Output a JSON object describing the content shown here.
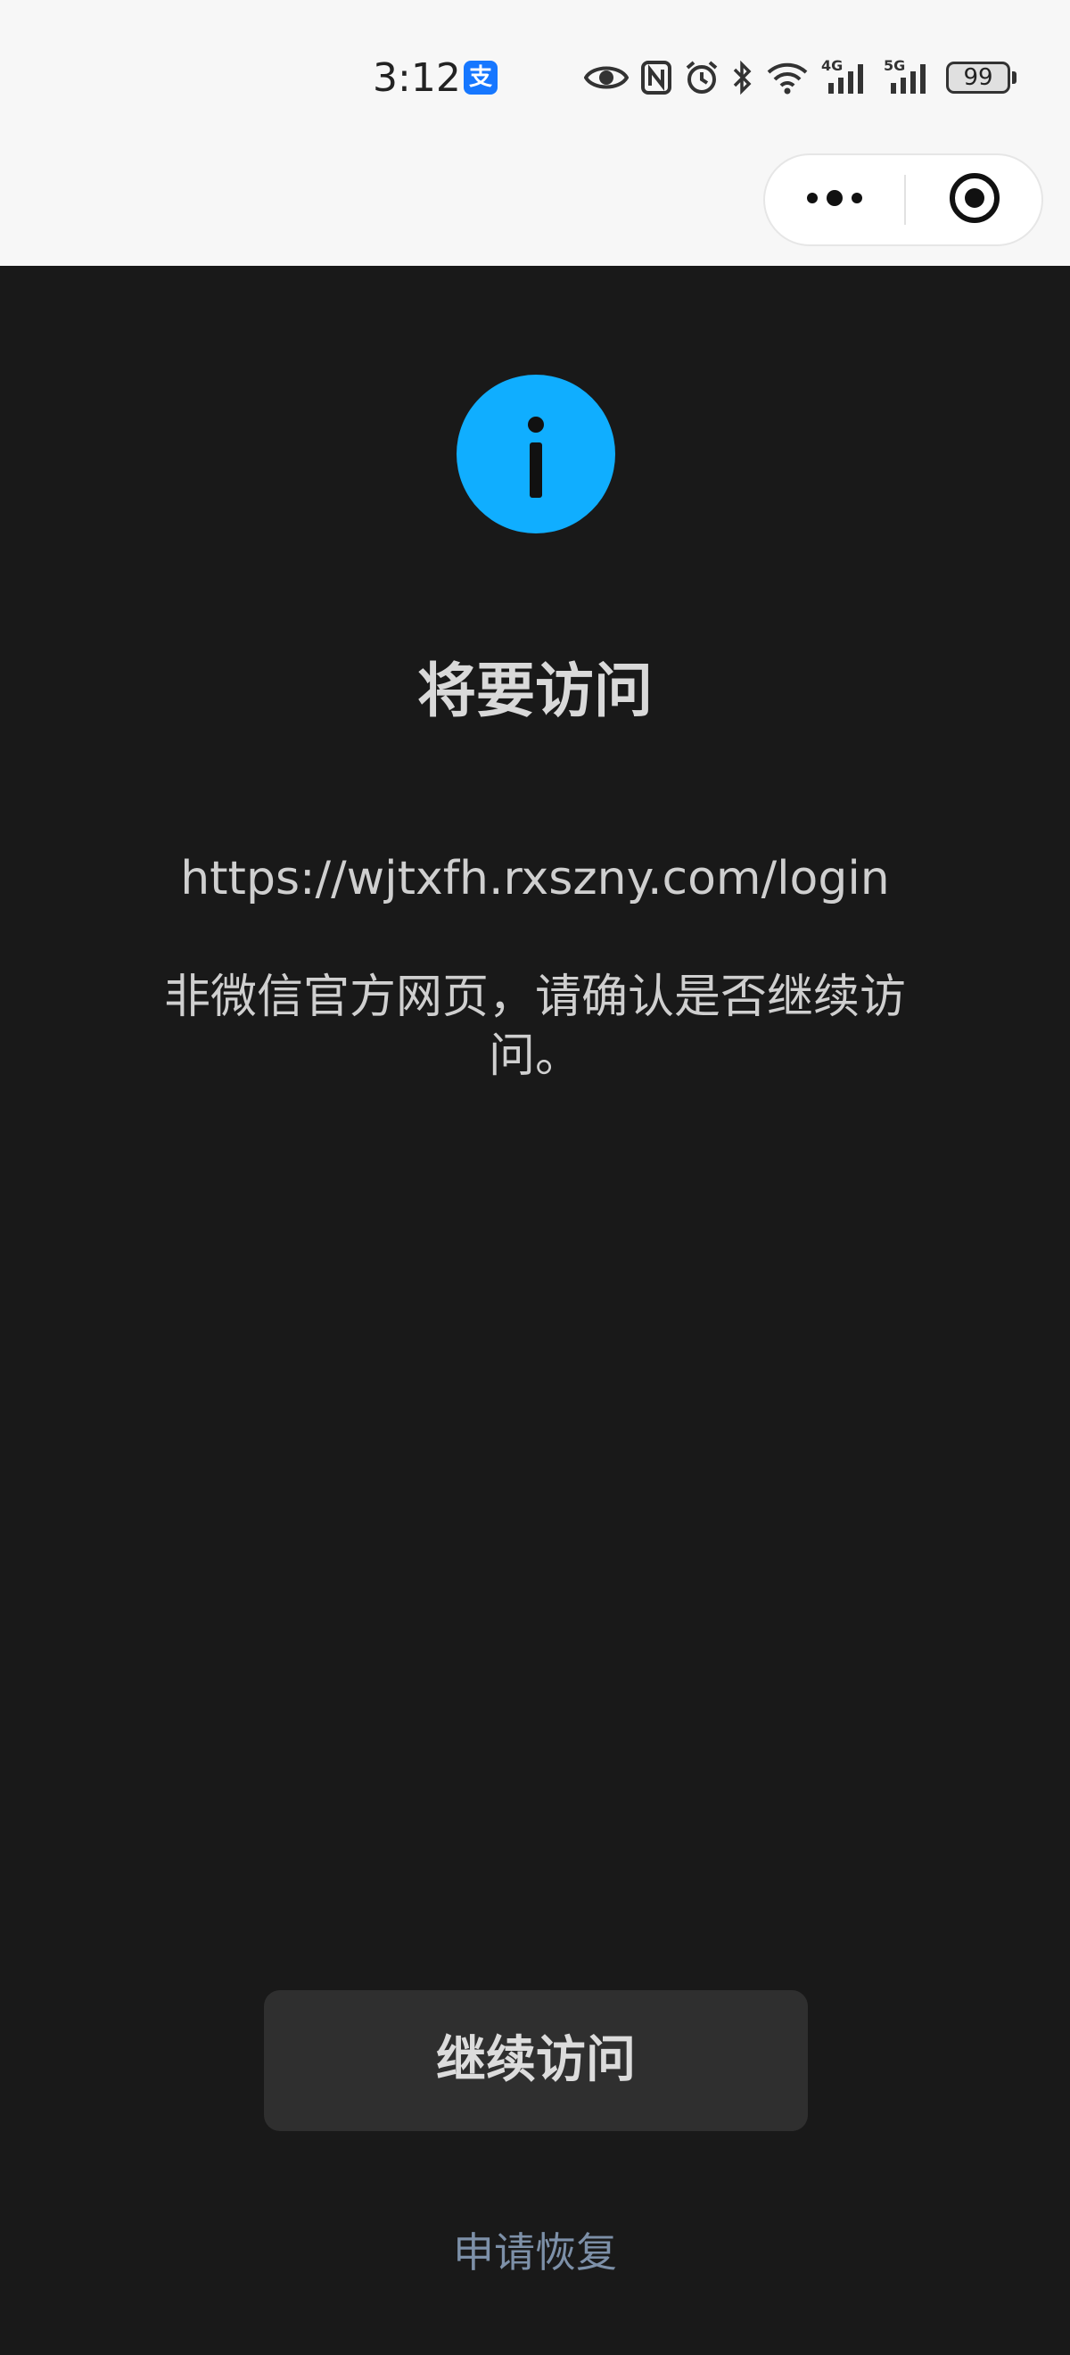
{
  "status_bar": {
    "time": "3:12",
    "alipay_badge": "支",
    "battery_level": "99",
    "network_labels": [
      "4G",
      "5G"
    ],
    "icons": [
      "eye-icon",
      "nfc-icon",
      "alarm-icon",
      "bluetooth-icon",
      "wifi-icon",
      "signal-4g-icon",
      "signal-5g-icon",
      "battery-icon"
    ]
  },
  "capsule": {
    "more_icon": "more-dots-icon",
    "close_icon": "close-miniprogram-icon"
  },
  "main": {
    "icon": "info-icon",
    "title": "将要访问",
    "url": "https://wjtxfh.rxszny.com/login",
    "description": "非微信官方网页，请确认是否继续访问。",
    "continue_label": "继续访问",
    "appeal_label": "申请恢复"
  },
  "colors": {
    "background": "#191919",
    "topbar": "#f7f7f7",
    "info_accent": "#10aeff",
    "button_bg": "#2f2f2f",
    "link": "#7d90a8",
    "alipay_brand": "#1677ff"
  }
}
